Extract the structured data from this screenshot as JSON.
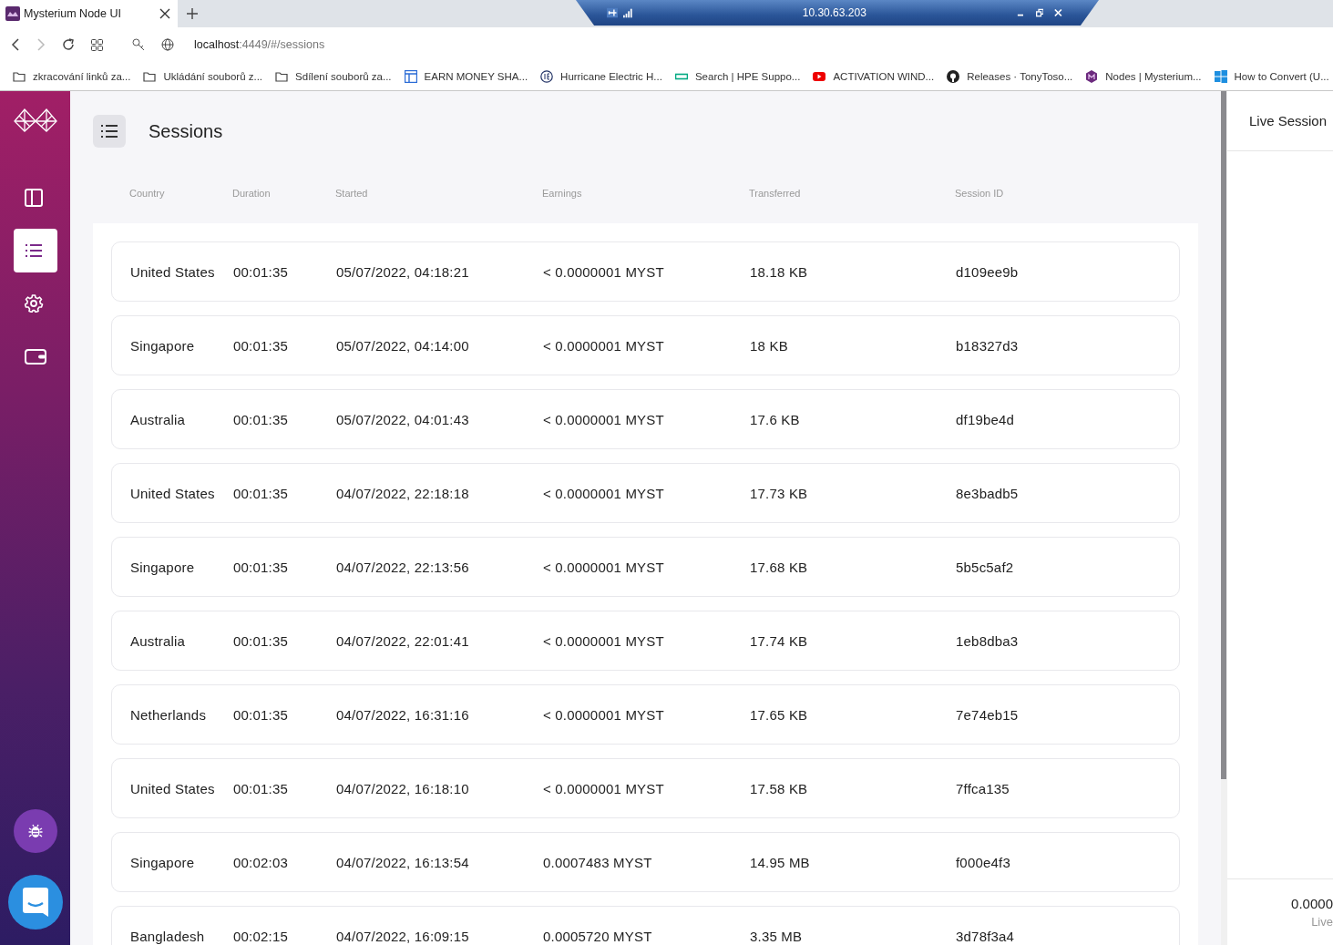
{
  "browser": {
    "tab": {
      "title": "Mysterium Node UI",
      "selected": true
    },
    "address": {
      "host": "localhost",
      "path": ":4449/#/sessions"
    },
    "bookmarks": [
      {
        "label": "zkracování linků za...",
        "kind": "folder"
      },
      {
        "label": "Ukládání souborů z...",
        "kind": "folder"
      },
      {
        "label": "Sdílení souborů za...",
        "kind": "folder"
      },
      {
        "label": "EARN MONEY SHA...",
        "kind": "layout"
      },
      {
        "label": "Hurricane Electric H...",
        "kind": "he"
      },
      {
        "label": "Search | HPE Suppo...",
        "kind": "hpe"
      },
      {
        "label": "ACTIVATION WIND...",
        "kind": "youtube"
      },
      {
        "label": "Releases · TonyToso...",
        "kind": "github"
      },
      {
        "label": "Nodes | Mysterium...",
        "kind": "mysterium"
      },
      {
        "label": "How to Convert (U...",
        "kind": "windows"
      }
    ],
    "remote_bar": {
      "title": "10.30.63.203"
    }
  },
  "sidebar": {
    "items": [
      {
        "kind": "dashboard",
        "selected": false
      },
      {
        "kind": "sessions",
        "selected": true
      },
      {
        "kind": "settings",
        "selected": false
      },
      {
        "kind": "wallet",
        "selected": false
      }
    ]
  },
  "page": {
    "title": "Sessions"
  },
  "table": {
    "columns": [
      "Country",
      "Duration",
      "Started",
      "Earnings",
      "Transferred",
      "Session ID"
    ],
    "rows": [
      {
        "country": "United States",
        "duration": "00:01:35",
        "started": "05/07/2022, 04:18:21",
        "earnings": "< 0.0000001 MYST",
        "transferred": "18.18 KB",
        "session_id": "d109ee9b"
      },
      {
        "country": "Singapore",
        "duration": "00:01:35",
        "started": "05/07/2022, 04:14:00",
        "earnings": "< 0.0000001 MYST",
        "transferred": "18 KB",
        "session_id": "b18327d3"
      },
      {
        "country": "Australia",
        "duration": "00:01:35",
        "started": "05/07/2022, 04:01:43",
        "earnings": "< 0.0000001 MYST",
        "transferred": "17.6 KB",
        "session_id": "df19be4d"
      },
      {
        "country": "United States",
        "duration": "00:01:35",
        "started": "04/07/2022, 22:18:18",
        "earnings": "< 0.0000001 MYST",
        "transferred": "17.73 KB",
        "session_id": "8e3badb5"
      },
      {
        "country": "Singapore",
        "duration": "00:01:35",
        "started": "04/07/2022, 22:13:56",
        "earnings": "< 0.0000001 MYST",
        "transferred": "17.68 KB",
        "session_id": "5b5c5af2"
      },
      {
        "country": "Australia",
        "duration": "00:01:35",
        "started": "04/07/2022, 22:01:41",
        "earnings": "< 0.0000001 MYST",
        "transferred": "17.74 KB",
        "session_id": "1eb8dba3"
      },
      {
        "country": "Netherlands",
        "duration": "00:01:35",
        "started": "04/07/2022, 16:31:16",
        "earnings": "< 0.0000001 MYST",
        "transferred": "17.65 KB",
        "session_id": "7e74eb15"
      },
      {
        "country": "United States",
        "duration": "00:01:35",
        "started": "04/07/2022, 16:18:10",
        "earnings": "< 0.0000001 MYST",
        "transferred": "17.58 KB",
        "session_id": "7ffca135"
      },
      {
        "country": "Singapore",
        "duration": "00:02:03",
        "started": "04/07/2022, 16:13:54",
        "earnings": "0.0007483 MYST",
        "transferred": "14.95 MB",
        "session_id": "f000e4f3"
      },
      {
        "country": "Bangladesh",
        "duration": "00:02:15",
        "started": "04/07/2022, 16:09:15",
        "earnings": "0.0005720 MYST",
        "transferred": "3.35 MB",
        "session_id": "3d78f3a4"
      }
    ]
  },
  "side_panel": {
    "title": "Live Session",
    "value": "0.0000",
    "caption": "Live"
  }
}
